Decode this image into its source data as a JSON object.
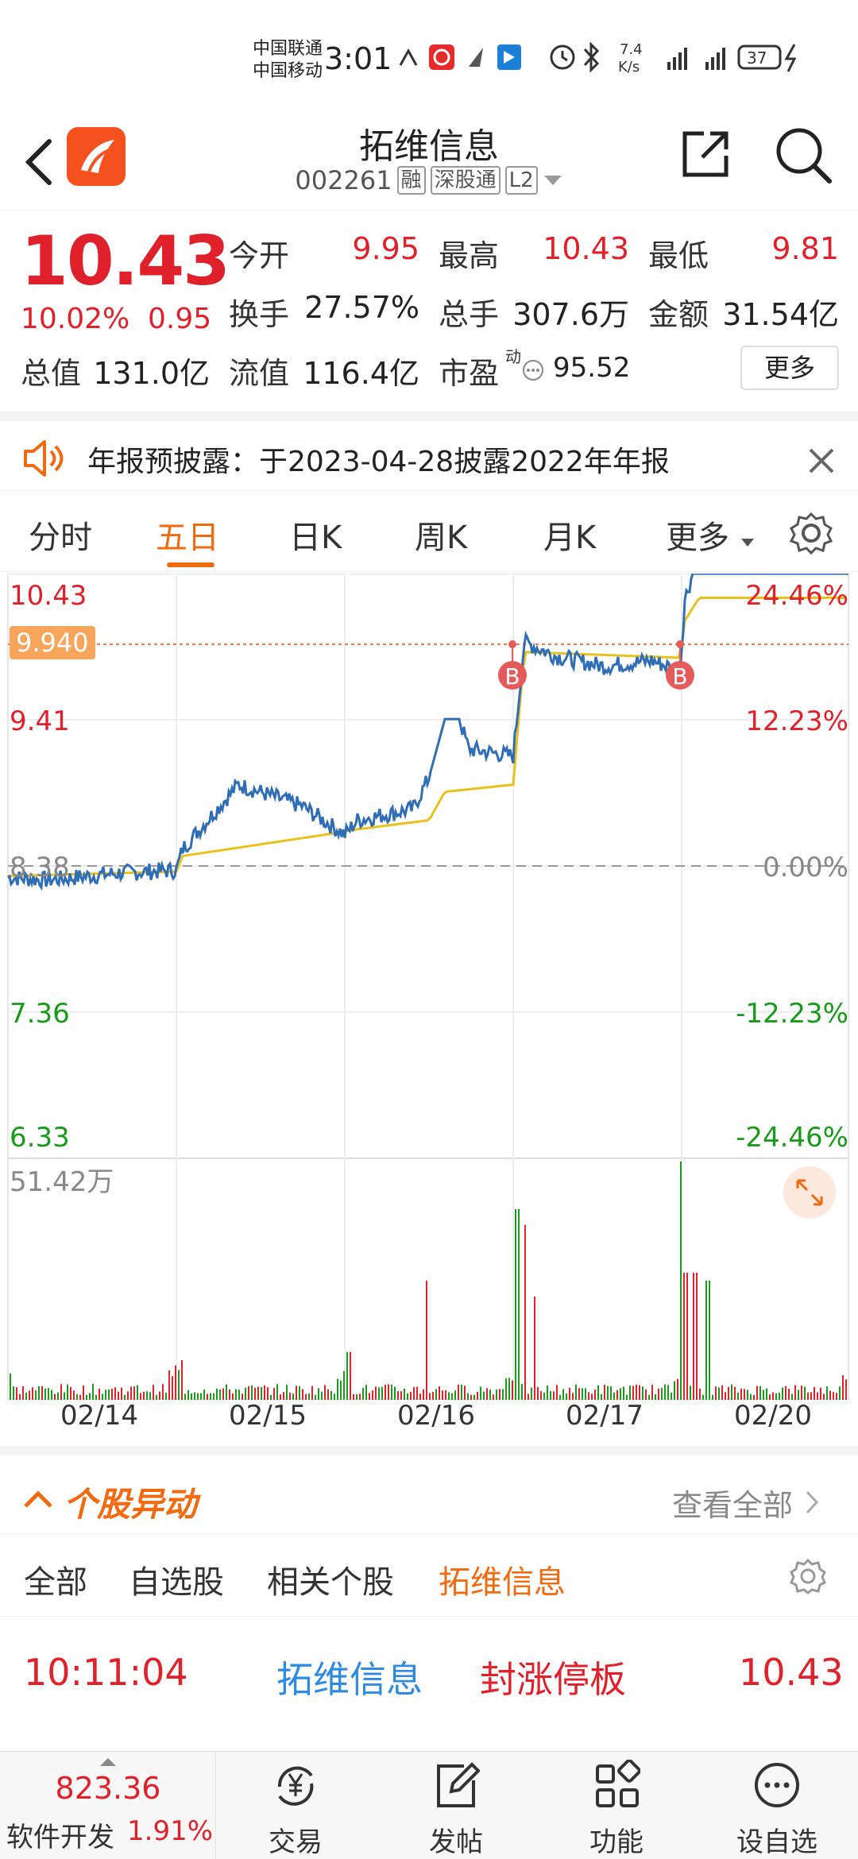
{
  "status_bar": {
    "carrier1": "中国联通",
    "carrier2": "中国移动",
    "time": "3:01",
    "net_speed_top": "7.4",
    "net_speed_bottom": "K/s",
    "battery": "37"
  },
  "header": {
    "title": "拓维信息",
    "code": "002261",
    "tags": [
      "融",
      "深股通",
      "L2"
    ]
  },
  "quote": {
    "price": "10.43",
    "change_pct": "10.02%",
    "change_amt": "0.95",
    "open_label": "今开",
    "open": "9.95",
    "high_label": "最高",
    "high": "10.43",
    "low_label": "最低",
    "low": "9.81",
    "turnover_label": "换手",
    "turnover": "27.57%",
    "volume_label": "总手",
    "volume": "307.6万",
    "amount_label": "金额",
    "amount": "31.54亿",
    "mktcap_label": "总值",
    "mktcap": "131.0亿",
    "float_label": "流值",
    "float": "116.4亿",
    "pe_label": "市盈",
    "pe_super": "动",
    "pe": "95.52",
    "more": "更多"
  },
  "notice": {
    "text": "年报预披露：于2023-04-28披露2022年年报"
  },
  "tabs": [
    "分时",
    "五日",
    "日K",
    "周K",
    "月K",
    "更多"
  ],
  "chart": {
    "y_left": [
      "10.43",
      "9.41",
      "8.38",
      "7.36",
      "6.33"
    ],
    "y_right": [
      "24.46%",
      "12.23%",
      "0.00%",
      "-12.23%",
      "-24.46%"
    ],
    "marker_price": "9.940",
    "marker_b": "B",
    "volume_max": "51.42万",
    "dates": [
      "02/14",
      "02/15",
      "02/16",
      "02/17",
      "02/20"
    ]
  },
  "section": {
    "title": "个股异动",
    "view_all": "查看全部",
    "subtabs": [
      "全部",
      "自选股",
      "相关个股",
      "拓维信息"
    ]
  },
  "event": {
    "time": "10:11:04",
    "name": "拓维信息",
    "type": "封涨停板",
    "price": "10.43"
  },
  "bottom": {
    "index_value": "823.36",
    "index_name": "软件开发",
    "index_pct": "1.91%",
    "nav": [
      "交易",
      "发帖",
      "功能",
      "设自选"
    ]
  },
  "colors": {
    "up": "#e0202a",
    "down": "#1a9a1a",
    "accent": "#f06a0f",
    "price_line": "#2f6db5",
    "avg_line": "#e8c21a"
  }
}
